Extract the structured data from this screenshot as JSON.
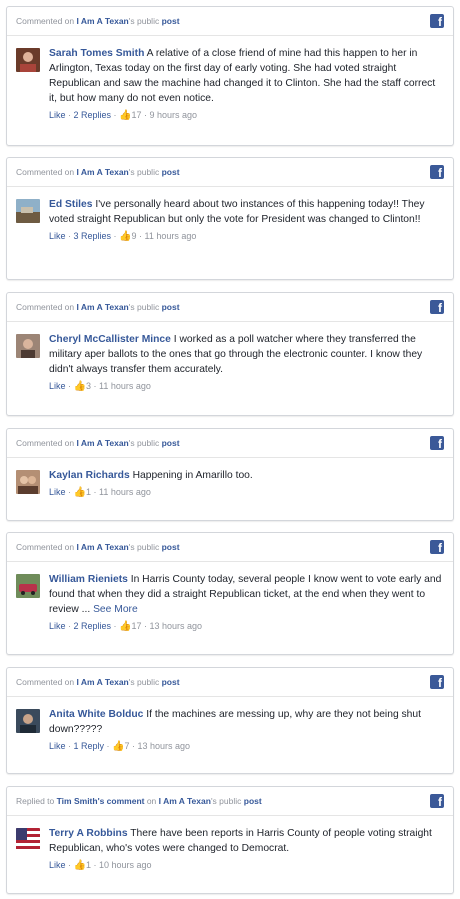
{
  "brand": {
    "accent": "#3b5998",
    "link": "#365899",
    "muted": "#90949c"
  },
  "cards": [
    {
      "head_prefix": "Commented on ",
      "head_page": "I Am A Texan",
      "head_suffix": "'s public ",
      "head_post": "post",
      "author": "Sarah Tomes Smith",
      "text": " A relative of a close friend of mine had this happen to her in Arlington, Texas today on the first day of early voting. She had voted straight Republican and saw the machine had changed it to Clinton. She had the staff correct it, but how many do not even notice.",
      "see_more": "",
      "like": "Like",
      "replies": "2 Replies",
      "likes": "17",
      "time": "9 hours ago",
      "avatar_icon": "user-avatar"
    },
    {
      "head_prefix": "Commented on ",
      "head_page": "I Am A Texan",
      "head_suffix": "'s public ",
      "head_post": "post",
      "author": "Ed Stiles",
      "text": " I've personally heard about two instances of this happening today!! They voted straight Republican but only the vote for President was changed to Clinton!!",
      "see_more": "",
      "like": "Like",
      "replies": "3 Replies",
      "likes": "9",
      "time": "11 hours ago",
      "avatar_icon": "user-avatar"
    },
    {
      "head_prefix": "Commented on ",
      "head_page": "I Am A Texan",
      "head_suffix": "'s public ",
      "head_post": "post",
      "author": "Cheryl McCallister Mince",
      "text": " I worked as a poll watcher where they transferred the military aper ballots to the ones that go through the electronic counter. I know they didn't always transfer them accurately.",
      "see_more": "",
      "like": "Like",
      "replies": "",
      "likes": "3",
      "time": "11 hours ago",
      "avatar_icon": "user-avatar"
    },
    {
      "head_prefix": "Commented on ",
      "head_page": "I Am A Texan",
      "head_suffix": "'s public ",
      "head_post": "post",
      "author": "Kaylan Richards",
      "text": " Happening in Amarillo too.",
      "see_more": "",
      "like": "Like",
      "replies": "",
      "likes": "1",
      "time": "11 hours ago",
      "avatar_icon": "user-avatar"
    },
    {
      "head_prefix": "Commented on ",
      "head_page": "I Am A Texan",
      "head_suffix": "'s public ",
      "head_post": "post",
      "author": "William Rieniets",
      "text": " In Harris County today, several people I know went to vote early and found that when they did a straight Republican ticket, at the end when they went to review ... ",
      "see_more": "See More",
      "like": "Like",
      "replies": "2 Replies",
      "likes": "17",
      "time": "13 hours ago",
      "avatar_icon": "user-avatar"
    },
    {
      "head_prefix": "Commented on ",
      "head_page": "I Am A Texan",
      "head_suffix": "'s public ",
      "head_post": "post",
      "author": "Anita White Bolduc",
      "text": " If the machines are messing up, why are they not being shut down?????",
      "see_more": "",
      "like": "Like",
      "replies": "1 Reply",
      "likes": "7",
      "time": "13 hours ago",
      "avatar_icon": "user-avatar"
    },
    {
      "head_prefix": "Replied to ",
      "head_reply_to": "Tim Smith's comment",
      "head_on": " on ",
      "head_page": "I Am A Texan",
      "head_suffix": "'s public ",
      "head_post": "post",
      "author": "Terry A Robbins",
      "text": " There have been reports in Harris County of people voting straight Republican, who's votes were changed to Democrat.",
      "see_more": "",
      "like": "Like",
      "replies": "",
      "likes": "1",
      "time": "10 hours ago",
      "avatar_icon": "user-avatar"
    }
  ]
}
